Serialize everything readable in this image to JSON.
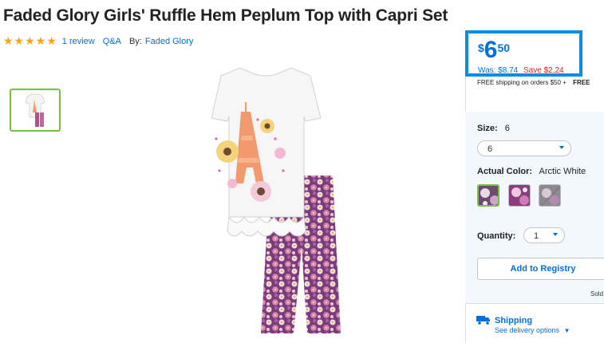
{
  "product": {
    "title": "Faded Glory Girls' Ruffle Hem Peplum Top with Capri Set",
    "stars": "★★★★★",
    "reviews": "1 review",
    "qa": "Q&A",
    "by_label": "By:",
    "brand": "Faded Glory"
  },
  "price": {
    "currency": "$",
    "dollars": "6",
    "cents": "50",
    "was": "Was: $8.74",
    "save": "Save $2.24",
    "shipping": "FREE shipping on orders $50 +",
    "shipping_extra": "FREE"
  },
  "options": {
    "size_label": "Size:",
    "size_value": "6",
    "size_select": "6",
    "color_label": "Actual Color:",
    "color_value": "Arctic White",
    "quantity_label": "Quantity:",
    "quantity_value": "1",
    "registry_button": "Add to Registry",
    "sold": "Sold"
  },
  "delivery": {
    "title": "Shipping",
    "link": "See delivery options"
  },
  "colors": {
    "accent": "#0071dc",
    "save": "#e2231a",
    "selected": "#76c043",
    "star": "#f9a51a"
  }
}
